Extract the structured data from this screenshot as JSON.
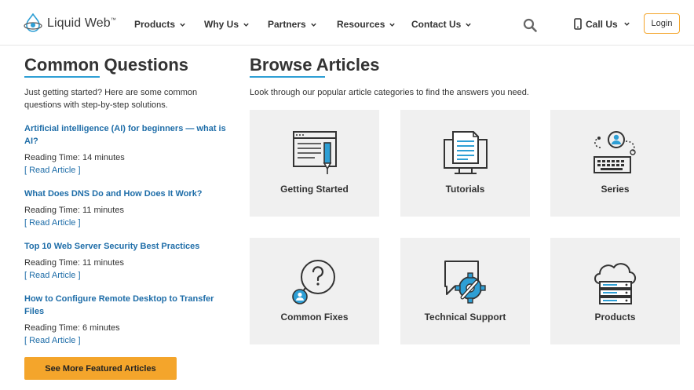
{
  "header": {
    "logo_text": "Liquid Web",
    "logo_tm": "™",
    "nav": [
      {
        "label": "Products"
      },
      {
        "label": "Why Us"
      },
      {
        "label": "Partners"
      },
      {
        "label": "Resources"
      },
      {
        "label": "Contact Us"
      }
    ],
    "call_us": "Call Us",
    "login": "Login"
  },
  "questions": {
    "title": "Common Questions",
    "intro": "Just getting started? Here are some common questions with step-by-step solutions.",
    "items": [
      {
        "title": "Artificial intelligence (AI) for beginners — what is AI?",
        "reading": "Reading Time: 14 minutes",
        "read_link": "[ Read Article ]"
      },
      {
        "title": "What Does DNS Do and How Does It Work?",
        "reading": "Reading Time: 11 minutes",
        "read_link": "[ Read Article ]"
      },
      {
        "title": "Top 10 Web Server Security Best Practices",
        "reading": "Reading Time: 11 minutes",
        "read_link": "[ Read Article ]"
      },
      {
        "title": "How to Configure Remote Desktop to Transfer Files",
        "reading": "Reading Time: 6 minutes",
        "read_link": "[ Read Article ]"
      }
    ],
    "featured_button": "See More Featured Articles"
  },
  "browse": {
    "title": "Browse Articles",
    "intro": "Look through our popular article categories to find the answers you need.",
    "categories": [
      {
        "label": "Getting Started",
        "icon": "browser-pencil-icon"
      },
      {
        "label": "Tutorials",
        "icon": "monitor-document-icon"
      },
      {
        "label": "Series",
        "icon": "user-keyboard-icon"
      },
      {
        "label": "Common Fixes",
        "icon": "question-bubble-icon"
      },
      {
        "label": "Technical Support",
        "icon": "chat-gear-wrench-icon"
      },
      {
        "label": "Products",
        "icon": "cloud-server-icon"
      }
    ]
  },
  "colors": {
    "accent_blue": "#2e9fd5",
    "link_blue": "#1e6da8",
    "orange": "#f4a52b",
    "card_bg": "#f0f0f0",
    "icon_dark": "#333333"
  }
}
